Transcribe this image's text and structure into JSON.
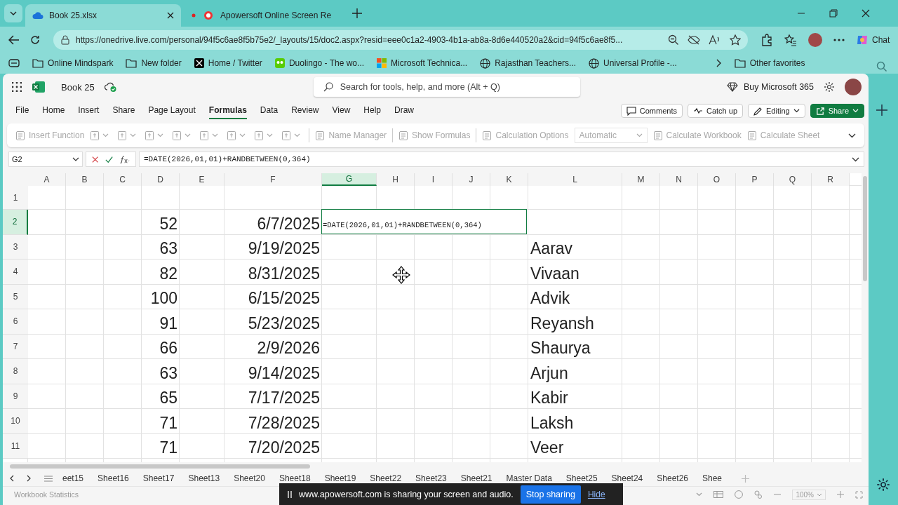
{
  "browser": {
    "tabs": [
      {
        "title": "Book 25.xlsx",
        "selected": true,
        "recording": false
      },
      {
        "title": "Apowersoft Online Screen Re",
        "selected": false,
        "recording": true
      }
    ],
    "url": "https://onedrive.live.com/personal/94f5c6ae8f5b75e2/_layouts/15/doc2.aspx?resid=eee0c1a2-4903-4b1a-ab8a-8d6e440520a2&cid=94f5c6ae8f5...",
    "chat_label": "Chat",
    "bookmarks": [
      {
        "label": "Online Mindspark",
        "kind": "folder"
      },
      {
        "label": "New folder",
        "kind": "folder"
      },
      {
        "label": "Home / Twitter",
        "kind": "x"
      },
      {
        "label": "Duolingo - The wo...",
        "kind": "owl"
      },
      {
        "label": "Microsoft Technica...",
        "kind": "ms"
      },
      {
        "label": "Rajasthan Teachers...",
        "kind": "globe"
      },
      {
        "label": "Universal Profile -...",
        "kind": "globe"
      }
    ],
    "other_favorites": "Other favorites"
  },
  "app": {
    "title": "Book 25",
    "search_placeholder": "Search for tools, help, and more (Alt + Q)",
    "buy_label": "Buy Microsoft 365",
    "menu": [
      {
        "label": "File",
        "selected": false
      },
      {
        "label": "Home",
        "selected": false
      },
      {
        "label": "Insert",
        "selected": false
      },
      {
        "label": "Share",
        "selected": false
      },
      {
        "label": "Page Layout",
        "selected": false
      },
      {
        "label": "Formulas",
        "selected": true
      },
      {
        "label": "Data",
        "selected": false
      },
      {
        "label": "Review",
        "selected": false
      },
      {
        "label": "View",
        "selected": false
      },
      {
        "label": "Help",
        "selected": false
      },
      {
        "label": "Draw",
        "selected": false
      }
    ],
    "actions": [
      {
        "label": "Comments",
        "kind": "comments"
      },
      {
        "label": "Catch up",
        "kind": "catchup"
      },
      {
        "label": "Editing",
        "kind": "editing"
      },
      {
        "label": "Share",
        "kind": "share"
      }
    ]
  },
  "ribbon": {
    "disabled": true,
    "items": [
      {
        "kind": "labeled",
        "label": "Insert Function"
      },
      {
        "kind": "menu"
      },
      {
        "kind": "menu"
      },
      {
        "kind": "menu"
      },
      {
        "kind": "menu"
      },
      {
        "kind": "menu"
      },
      {
        "kind": "menu"
      },
      {
        "kind": "menu"
      },
      {
        "kind": "menu"
      },
      {
        "kind": "separator"
      },
      {
        "kind": "labeled",
        "label": "Name Manager"
      },
      {
        "kind": "separator"
      },
      {
        "kind": "labeled",
        "label": "Show Formulas"
      },
      {
        "kind": "separator"
      },
      {
        "kind": "labeled",
        "label": "Calculation Options"
      },
      {
        "kind": "select",
        "value": "Automatic"
      },
      {
        "kind": "labeled",
        "label": "Calculate Workbook"
      },
      {
        "kind": "labeled",
        "label": "Calculate Sheet"
      }
    ]
  },
  "formula_bar": {
    "name_box": "G2",
    "formula": "=DATE(2026,01,01)+RANDBETWEEN(0,364)"
  },
  "sheet": {
    "columns": [
      {
        "label": "A",
        "selected": false
      },
      {
        "label": "B",
        "selected": false
      },
      {
        "label": "C",
        "selected": false
      },
      {
        "label": "D",
        "selected": false
      },
      {
        "label": "E",
        "selected": false
      },
      {
        "label": "F",
        "selected": false
      },
      {
        "label": "G",
        "selected": true
      },
      {
        "label": "H",
        "selected": false
      },
      {
        "label": "I",
        "selected": false
      },
      {
        "label": "J",
        "selected": false
      },
      {
        "label": "K",
        "selected": false
      },
      {
        "label": "L",
        "selected": false
      },
      {
        "label": "M",
        "selected": false
      },
      {
        "label": "N",
        "selected": false
      },
      {
        "label": "O",
        "selected": false
      },
      {
        "label": "P",
        "selected": false
      },
      {
        "label": "Q",
        "selected": false
      },
      {
        "label": "R",
        "selected": false
      }
    ],
    "rows": [
      {
        "label": "1",
        "selected": false
      },
      {
        "label": "2",
        "selected": true,
        "cells": {
          "D": {
            "kind": "number",
            "text": "52"
          },
          "F": {
            "kind": "number",
            "text": "6/7/2025"
          },
          "G": {
            "kind": "formula",
            "text": "=DATE(2026,01,01)+RANDBETWEEN(0,364)"
          }
        }
      },
      {
        "label": "3",
        "selected": false,
        "cells": {
          "D": {
            "kind": "number",
            "text": "63"
          },
          "F": {
            "kind": "number",
            "text": "9/19/2025"
          },
          "L": {
            "kind": "text",
            "text": "Aarav"
          }
        }
      },
      {
        "label": "4",
        "selected": false,
        "cells": {
          "D": {
            "kind": "number",
            "text": "82"
          },
          "F": {
            "kind": "number",
            "text": "8/31/2025"
          },
          "L": {
            "kind": "text",
            "text": "Vivaan"
          }
        }
      },
      {
        "label": "5",
        "selected": false,
        "cells": {
          "D": {
            "kind": "number",
            "text": "100"
          },
          "F": {
            "kind": "number",
            "text": "6/15/2025"
          },
          "L": {
            "kind": "text",
            "text": "Advik"
          }
        }
      },
      {
        "label": "6",
        "selected": false,
        "cells": {
          "D": {
            "kind": "number",
            "text": "91"
          },
          "F": {
            "kind": "number",
            "text": "5/23/2025"
          },
          "L": {
            "kind": "text",
            "text": "Reyansh"
          }
        }
      },
      {
        "label": "7",
        "selected": false,
        "cells": {
          "D": {
            "kind": "number",
            "text": "66"
          },
          "F": {
            "kind": "number",
            "text": "2/9/2026"
          },
          "L": {
            "kind": "text",
            "text": "Shaurya"
          }
        }
      },
      {
        "label": "8",
        "selected": false,
        "cells": {
          "D": {
            "kind": "number",
            "text": "63"
          },
          "F": {
            "kind": "number",
            "text": "9/14/2025"
          },
          "L": {
            "kind": "text",
            "text": "Arjun"
          }
        }
      },
      {
        "label": "9",
        "selected": false,
        "cells": {
          "D": {
            "kind": "number",
            "text": "65"
          },
          "F": {
            "kind": "number",
            "text": "7/17/2025"
          },
          "L": {
            "kind": "text",
            "text": "Kabir"
          }
        }
      },
      {
        "label": "10",
        "selected": false,
        "cells": {
          "D": {
            "kind": "number",
            "text": "71"
          },
          "F": {
            "kind": "number",
            "text": "7/28/2025"
          },
          "L": {
            "kind": "text",
            "text": "Laksh"
          }
        }
      },
      {
        "label": "11",
        "selected": false,
        "cells": {
          "D": {
            "kind": "number",
            "text": "71"
          },
          "F": {
            "kind": "number",
            "text": "7/20/2025"
          },
          "L": {
            "kind": "text",
            "text": "Veer"
          }
        }
      }
    ]
  },
  "sheet_tabs": [
    "eet15",
    "Sheet16",
    "Sheet17",
    "Sheet13",
    "Sheet20",
    "Sheet18",
    "Sheet19",
    "Sheet22",
    "Sheet23",
    "Sheet21",
    "Master Data",
    "Sheet25",
    "Sheet24",
    "Sheet26",
    "Shee"
  ],
  "status_bar": {
    "left": "Workbook Statistics",
    "zoom": "100%"
  },
  "share_notice": {
    "text": "www.apowersoft.com is sharing your screen and audio.",
    "stop": "Stop sharing",
    "hide": "Hide"
  }
}
